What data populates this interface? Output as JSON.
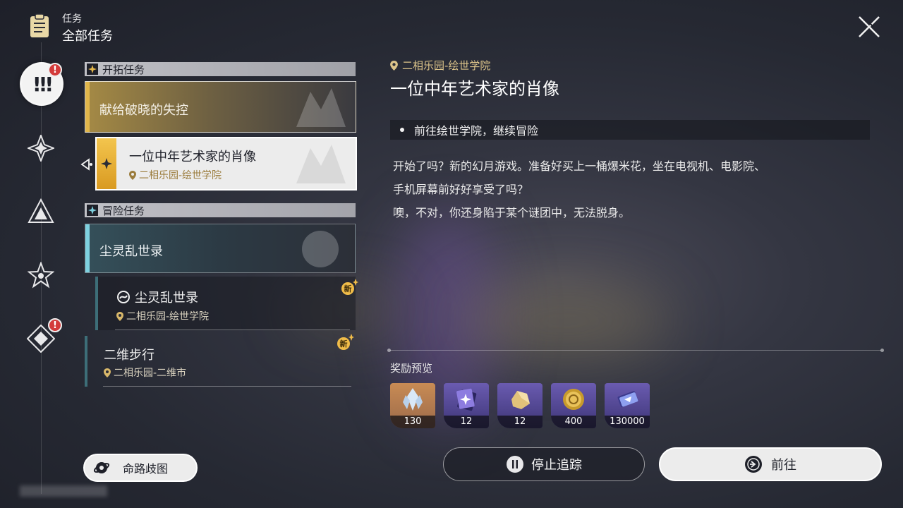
{
  "header": {
    "section": "任务",
    "title": "全部任务"
  },
  "sections": {
    "trailblaze": {
      "label": "开拓任务"
    },
    "adventure": {
      "label": "冒险任务"
    }
  },
  "quests": {
    "trailblaze_1": {
      "title": "献给破晓的失控"
    },
    "trailblaze_2": {
      "title": "一位中年艺术家的肖像",
      "location": "二相乐园-绘世学院"
    },
    "adventure_1": {
      "title": "尘灵乱世录"
    },
    "adventure_2": {
      "title": "尘灵乱世录",
      "location": "二相乐园-绘世学院",
      "badge": "新"
    },
    "adventure_3": {
      "title": "二维步行",
      "location": "二相乐园-二维市",
      "badge": "新"
    }
  },
  "detail": {
    "location": "二相乐园-绘世学院",
    "title": "一位中年艺术家的肖像",
    "objective": "前往绘世学院，继续冒险",
    "description_lines": [
      "开始了吗？新的幻月游戏。准备好买上一桶爆米花，坐在电视机、电影院、",
      "手机屏幕前好好享受了吗？",
      "噢，不对，你还身陷于某个谜团中，无法脱身。"
    ]
  },
  "rewards": {
    "label": "奖励预览",
    "items": [
      {
        "icon": "crystal-icon",
        "count": "130",
        "tint": "#c88b54"
      },
      {
        "icon": "book-icon",
        "count": "12",
        "tint": "#6a5bb0"
      },
      {
        "icon": "ore-icon",
        "count": "12",
        "tint": "#6a5bb0"
      },
      {
        "icon": "credit-coin-icon",
        "count": "400",
        "tint": "#6a5bb0"
      },
      {
        "icon": "exp-card-icon",
        "count": "130000",
        "tint": "#6a5bb0"
      }
    ]
  },
  "buttons": {
    "path_map": "命路歧图",
    "stop_tracking": "停止追踪",
    "go": "前往"
  },
  "alerts": {
    "rail_1": "!",
    "rail_5": "!"
  }
}
